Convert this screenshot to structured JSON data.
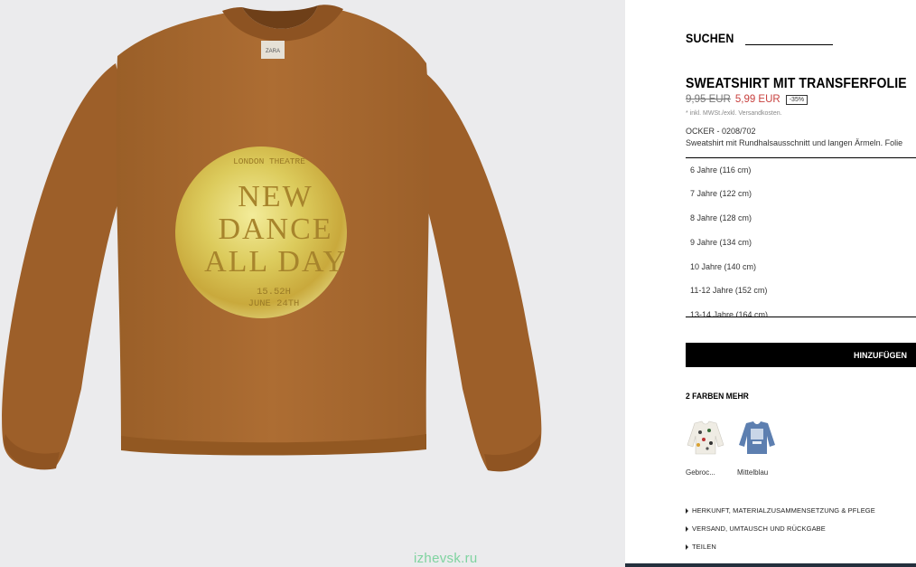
{
  "search": {
    "label": "SUCHEN",
    "placeholder": ""
  },
  "product": {
    "title": "SWEATSHIRT MIT TRANSFERFOLIE",
    "old_price": "9,95 EUR",
    "new_price": "5,99 EUR",
    "discount": "-35%",
    "tax_note": "* inkl. MWSt./exkl. Versandkosten.",
    "color_ref": "OCKER - 0208/702",
    "description": "Sweatshirt mit Rundhalsausschnitt und langen Ärmeln. Folie"
  },
  "print": {
    "top": "LONDON THEATRE",
    "line1": "NEW",
    "line2": "DANCE",
    "line3": "ALL DAY",
    "time": "15.52H",
    "date": "JUNE 24TH",
    "tag": "ZARA"
  },
  "sizes": [
    "6 Jahre (116 cm)",
    "7 Jahre (122 cm)",
    "8 Jahre (128 cm)",
    "9 Jahre (134 cm)",
    "10 Jahre (140 cm)",
    "11-12 Jahre (152 cm)",
    "13-14 Jahre (164 cm)"
  ],
  "add_button": "HINZUFÜGEN",
  "more_colors": {
    "title": "2 FARBEN MEHR",
    "items": [
      {
        "label": "Gebroc...",
        "color": "#efece4"
      },
      {
        "label": "Mittelblau",
        "color": "#5d7fb0"
      }
    ]
  },
  "info_links": [
    "HERKUNFT, MATERIALZUSAMMENSETZUNG & PFLEGE",
    "VERSAND, UMTAUSCH UND RÜCKGABE",
    "TEILEN"
  ],
  "watermark": "izhevsk.ru",
  "colors": {
    "sweatshirt": "#a7682f",
    "gold": "#d6c255",
    "sale_red": "#c8403e"
  }
}
